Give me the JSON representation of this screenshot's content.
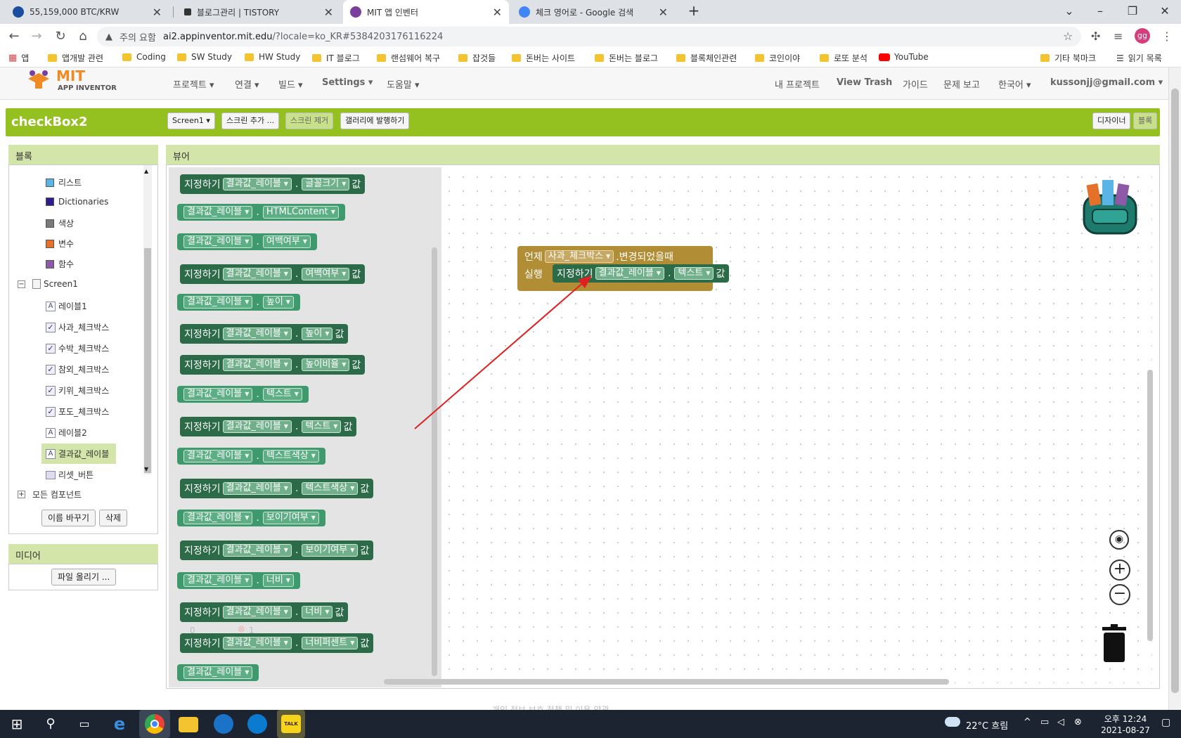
{
  "tabs": [
    {
      "title": "55,159,000 BTC/KRW",
      "icon_color": "#1a4fa0"
    },
    {
      "title": "블로그관리 | TISTORY",
      "icon_color": "#333333"
    },
    {
      "title": "MIT 앱 인벤터",
      "icon_color": "#7a3e9d"
    },
    {
      "title": "체크 영어로 - Google 검색",
      "icon_color": "#4285f4"
    }
  ],
  "address": {
    "warning": "주의 요함",
    "host": "ai2.appinventor.mit.edu",
    "path": "/?locale=ko_KR#5384203176116224",
    "profile": "gg"
  },
  "bookmarks": [
    "앱",
    "앱개발 관련",
    "Coding",
    "SW Study",
    "HW Study",
    "IT 블로그",
    "랜섬웨어 복구",
    "잡것들",
    "돈버는 사이트",
    "돈버는 블로그",
    "블록체인관련",
    "코인이야",
    "로또 분석",
    "YouTube",
    "기타 북마크",
    "읽기 목록"
  ],
  "app": {
    "logo_top": "MIT",
    "logo_bottom": "APP INVENTOR",
    "menus": [
      "프로젝트 ▾",
      "연결 ▾",
      "빌드 ▾",
      "Settings ▾",
      "도움말 ▾"
    ],
    "right_menus": [
      "내 프로젝트",
      "View Trash",
      "가이드",
      "문제 보고",
      "한국어 ▾",
      "kussonjj@gmail.com ▾"
    ],
    "project_name": "checkBox2",
    "screen_select": "Screen1 ▾",
    "buttons": [
      "스크린 추가 ...",
      "스크린 제거",
      "갤러리에 발행하기"
    ],
    "mode_buttons": [
      "디자이너",
      "블록"
    ]
  },
  "blocks_panel": {
    "title": "블록",
    "builtins": [
      {
        "label": "리스트",
        "color": "#5ab4e5"
      },
      {
        "label": "Dictionaries",
        "color": "#2d1e8c"
      },
      {
        "label": "색상",
        "color": "#7a7a7a"
      },
      {
        "label": "변수",
        "color": "#e5702a"
      },
      {
        "label": "함수",
        "color": "#8e5aa8"
      }
    ],
    "screen": "Screen1",
    "components": [
      {
        "label": "레이블1",
        "kind": "label"
      },
      {
        "label": "사과_체크박스",
        "kind": "check"
      },
      {
        "label": "수박_체크박스",
        "kind": "check"
      },
      {
        "label": "참외_체크박스",
        "kind": "check"
      },
      {
        "label": "키위_체크박스",
        "kind": "check"
      },
      {
        "label": "포도_체크박스",
        "kind": "check"
      },
      {
        "label": "레이블2",
        "kind": "label"
      },
      {
        "label": "결과값_레이블",
        "kind": "label"
      },
      {
        "label": "리셋_버튼",
        "kind": "button"
      }
    ],
    "all_components": "모든 컴포넌트",
    "rename": "이름 바꾸기",
    "delete": "삭제"
  },
  "media": {
    "title": "미디어",
    "upload": "파일 올리기 ..."
  },
  "viewer": {
    "title": "뷰어"
  },
  "flyout": [
    {
      "type": "set",
      "comp": "결과값_레이블",
      "prop": "글꼴크기"
    },
    {
      "type": "get",
      "comp": "결과값_레이블",
      "prop": "HTMLContent"
    },
    {
      "type": "get",
      "comp": "결과값_레이블",
      "prop": "여백여부"
    },
    {
      "type": "set",
      "comp": "결과값_레이블",
      "prop": "여백여부"
    },
    {
      "type": "get",
      "comp": "결과값_레이블",
      "prop": "높이"
    },
    {
      "type": "set",
      "comp": "결과값_레이블",
      "prop": "높이"
    },
    {
      "type": "set",
      "comp": "결과값_레이블",
      "prop": "높이비율"
    },
    {
      "type": "get",
      "comp": "결과값_레이블",
      "prop": "텍스트"
    },
    {
      "type": "set",
      "comp": "결과값_레이블",
      "prop": "텍스트"
    },
    {
      "type": "get",
      "comp": "결과값_레이블",
      "prop": "텍스트색상"
    },
    {
      "type": "set",
      "comp": "결과값_레이블",
      "prop": "텍스트색상"
    },
    {
      "type": "get",
      "comp": "결과값_레이블",
      "prop": "보이기여부"
    },
    {
      "type": "set",
      "comp": "결과값_레이블",
      "prop": "보이기여부"
    },
    {
      "type": "get",
      "comp": "결과값_레이블",
      "prop": "너비"
    },
    {
      "type": "set",
      "comp": "결과값_레이블",
      "prop": "너비"
    },
    {
      "type": "set",
      "comp": "결과값_레이블",
      "prop": "너비퍼센트"
    },
    {
      "type": "get",
      "comp": "결과값_레이블",
      "prop": ""
    }
  ],
  "block_words": {
    "set": "지정하기",
    "value": "값",
    "when": "언제",
    "do": "실행"
  },
  "event_block": {
    "component": "사과_체크박스",
    "event": ".변경되었을때",
    "set_comp": "결과값_레이블",
    "set_prop": "텍스트"
  },
  "warnings": {
    "warn_count": "0",
    "error_count": "1"
  },
  "footer_text": "개인 정보 보호 정책 및 이용 약관",
  "taskbar": {
    "weather": "22°C 흐림",
    "time": "오후 12:24",
    "date": "2021-08-27"
  },
  "colors": {
    "accent_green": "#94c11f",
    "block_dark": "#2b6b48",
    "block_light": "#3e9a6c",
    "event_gold": "#b18e35",
    "arrow_red": "#e02020"
  }
}
